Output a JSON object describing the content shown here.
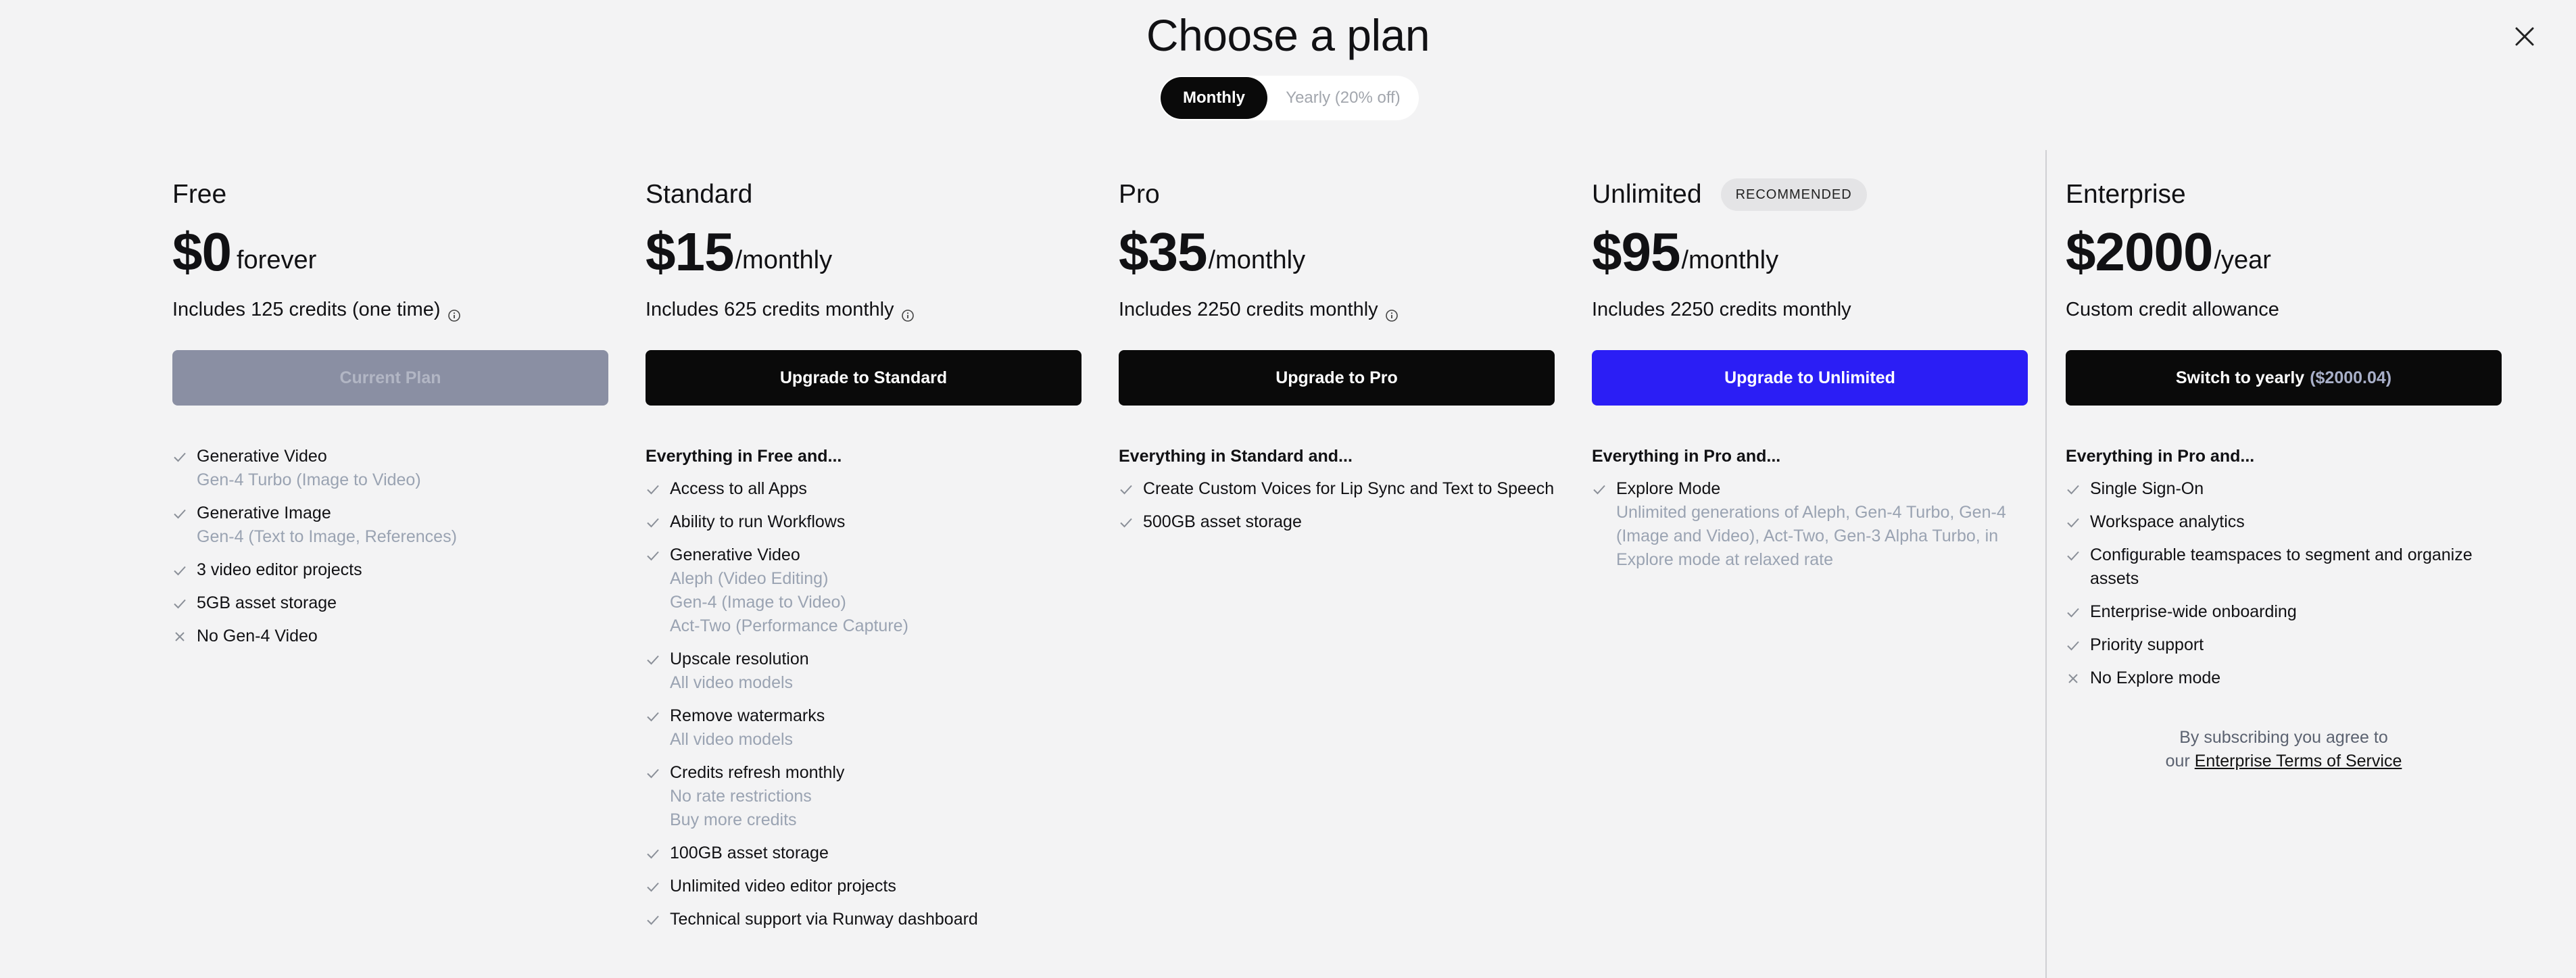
{
  "header": {
    "title": "Choose a plan",
    "close_icon": "close-icon"
  },
  "billing_toggle": {
    "monthly": "Monthly",
    "yearly": "Yearly (20% off)",
    "selected": "Monthly"
  },
  "plans": [
    {
      "name": "Free",
      "price": "$0",
      "period": "forever",
      "credits": "Includes 125 credits (one time)",
      "cta": "Current Plan",
      "section": "",
      "features": [
        {
          "icon": "check-icon",
          "text": "Generative Video",
          "subs": [
            "Gen-4 Turbo (Image to Video)"
          ]
        },
        {
          "icon": "check-icon",
          "text": "Generative Image",
          "subs": [
            "Gen-4 (Text to Image, References)"
          ]
        },
        {
          "icon": "check-icon",
          "text": "3 video editor projects",
          "subs": []
        },
        {
          "icon": "check-icon",
          "text": "5GB asset storage",
          "subs": []
        },
        {
          "icon": "x-icon",
          "text": "No Gen-4 Video",
          "subs": []
        }
      ]
    },
    {
      "name": "Standard",
      "price": "$15",
      "period": "/monthly",
      "credits": "Includes 625 credits monthly",
      "cta": "Upgrade to Standard",
      "section": "Everything in Free and...",
      "features": [
        {
          "icon": "check-icon",
          "text": "Access to all Apps",
          "subs": []
        },
        {
          "icon": "check-icon",
          "text": "Ability to run Workflows",
          "subs": []
        },
        {
          "icon": "check-icon",
          "text": "Generative Video",
          "subs": [
            "Aleph (Video Editing)",
            "Gen-4 (Image to Video)",
            "Act-Two (Performance Capture)"
          ]
        },
        {
          "icon": "check-icon",
          "text": "Upscale resolution",
          "subs": [
            "All video models"
          ]
        },
        {
          "icon": "check-icon",
          "text": "Remove watermarks",
          "subs": [
            "All video models"
          ]
        },
        {
          "icon": "check-icon",
          "text": "Credits refresh monthly",
          "subs": [
            "No rate restrictions",
            "Buy more credits"
          ]
        },
        {
          "icon": "check-icon",
          "text": "100GB asset storage",
          "subs": []
        },
        {
          "icon": "check-icon",
          "text": "Unlimited video editor projects",
          "subs": []
        },
        {
          "icon": "check-icon",
          "text": "Technical support via Runway dashboard",
          "subs": []
        }
      ]
    },
    {
      "name": "Pro",
      "price": "$35",
      "period": "/monthly",
      "credits": "Includes 2250 credits monthly",
      "cta": "Upgrade to Pro",
      "section": "Everything in Standard and...",
      "features": [
        {
          "icon": "check-icon",
          "text": "Create Custom Voices for Lip Sync and Text to Speech",
          "subs": []
        },
        {
          "icon": "check-icon",
          "text": "500GB asset storage",
          "subs": []
        }
      ]
    },
    {
      "name": "Unlimited",
      "badge": "RECOMMENDED",
      "price": "$95",
      "period": "/monthly",
      "credits": "Includes 2250 credits monthly",
      "cta": "Upgrade to Unlimited",
      "section": "Everything in Pro and...",
      "features": [
        {
          "icon": "check-icon",
          "text": "Explore Mode",
          "subs": [
            "Unlimited generations of Aleph, Gen-4 Turbo, Gen-4 (Image and Video), Act-Two, Gen-3 Alpha Turbo, in Explore mode at relaxed rate"
          ]
        }
      ]
    },
    {
      "name": "Enterprise",
      "price": "$2000",
      "period": "/year",
      "credits": "Custom credit allowance",
      "cta": "Switch to yearly",
      "cta_extra": "($2000.04)",
      "section": "Everything in Pro and...",
      "features": [
        {
          "icon": "check-icon",
          "text": "Single Sign-On",
          "subs": []
        },
        {
          "icon": "check-icon",
          "text": "Workspace analytics",
          "subs": []
        },
        {
          "icon": "check-icon",
          "text": "Configurable teamspaces to segment and organize assets",
          "subs": []
        },
        {
          "icon": "check-icon",
          "text": "Enterprise-wide onboarding",
          "subs": []
        },
        {
          "icon": "check-icon",
          "text": "Priority support",
          "subs": []
        },
        {
          "icon": "x-icon",
          "text": "No Explore mode",
          "subs": []
        }
      ]
    }
  ],
  "terms": {
    "line1": "By subscribing you agree to",
    "prefix": "our",
    "link": "Enterprise Terms of Service"
  },
  "colors": {
    "accent_blue": "#2b1ef5",
    "muted_text": "#9aa3b2",
    "background": "#f3f3f4"
  }
}
